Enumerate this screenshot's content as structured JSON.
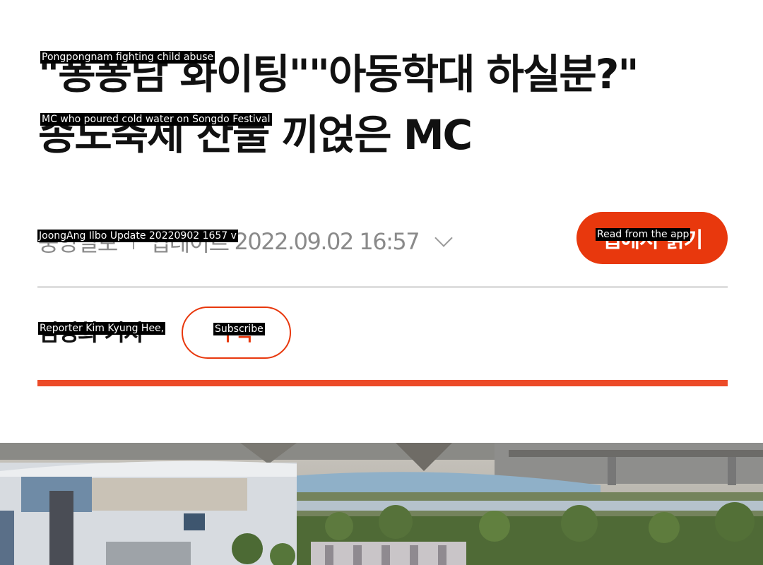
{
  "headline": {
    "line1": "\"퐁퐁남 화이팅\"\"아동학대 하실분?\"",
    "line2": "송도축제 찬물 끼얹은 MC"
  },
  "overlays": {
    "headline_line1": "Pongpongnam fighting child abuse",
    "headline_line2": "MC who poured cold water on Songdo Festival",
    "meta": "JoongAng Ilbo Update 20220902 1657 v",
    "app_button": "Read from the app",
    "reporter": "Reporter Kim Kyung Hee,",
    "subscribe": "Subscribe"
  },
  "meta": {
    "source": "중앙일보",
    "update_label": "업데이트",
    "date": "2022.09.02 16:57"
  },
  "buttons": {
    "app_read": "앱에서 읽기",
    "subscribe": "구독"
  },
  "reporter": {
    "name": "김경희 기자"
  },
  "colors": {
    "accent": "#e8380d",
    "accent_bar": "#ec4b28",
    "meta_gray": "#8a8a8a",
    "divider": "#dedede"
  },
  "icons": {
    "expand": "chevron-down-icon"
  }
}
